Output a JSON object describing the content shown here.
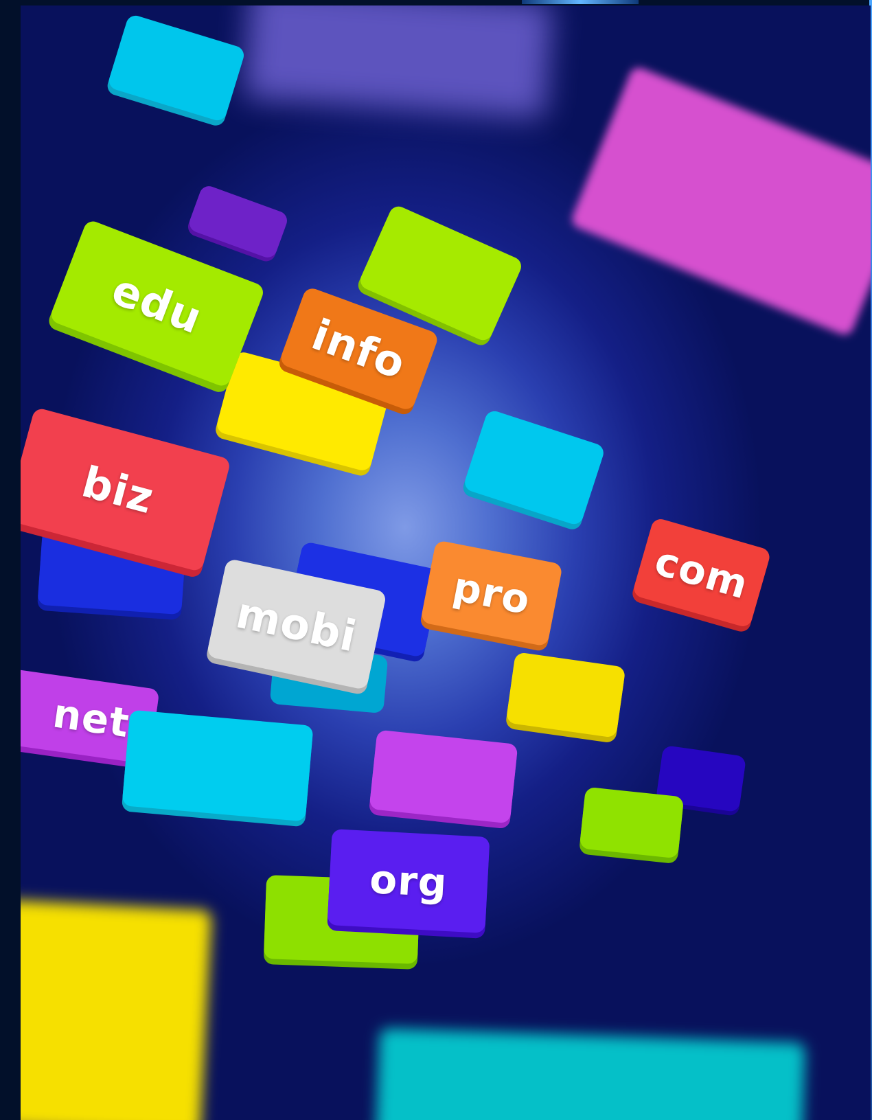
{
  "labels": {
    "edu": "edu",
    "info": "info",
    "biz": "biz",
    "mobi": "mobi",
    "pro": "pro",
    "com": "com",
    "net": "net",
    "org": "org"
  },
  "colors": {
    "background": "#0b1670",
    "cyan": "#00c8f0",
    "green": "#a4ea00",
    "orange": "#f07818",
    "yellow": "#ffe800",
    "red": "#f04050",
    "blue": "#1a2ee0",
    "gray": "#dcdcdc",
    "purple": "#c040e8",
    "violet": "#5a1ef0",
    "magenta": "#d850d0"
  }
}
